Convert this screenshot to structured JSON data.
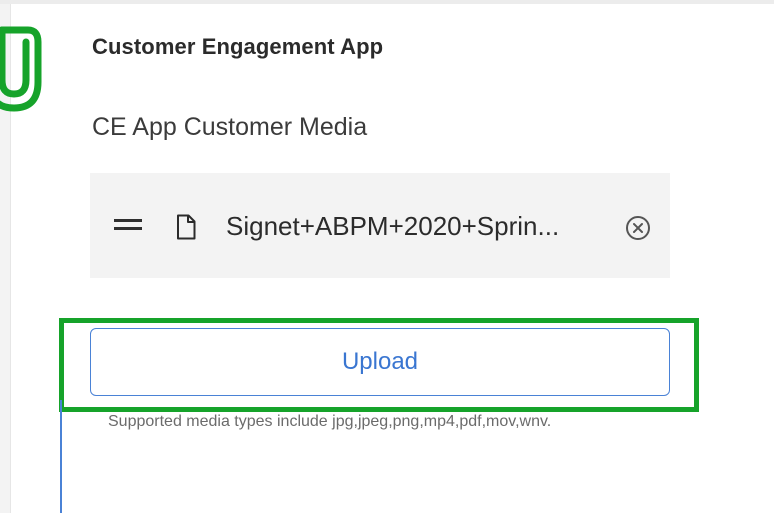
{
  "app": {
    "title": "Customer Engagement App"
  },
  "media_section": {
    "label": "CE App Customer Media",
    "file": {
      "name": "Signet+ABPM+2020+Sprin..."
    },
    "upload_label": "Upload",
    "supported_text": "Supported media types include jpg,jpeg,png,mp4,pdf,mov,wnv."
  },
  "icons": {
    "drag": "drag-handle-icon",
    "file": "file-icon",
    "remove": "remove-circle-x-icon",
    "annotation": "paperclip-icon"
  },
  "colors": {
    "highlight": "#16a32a",
    "accent": "#3a76d1",
    "file_bg": "#f3f3f3"
  }
}
